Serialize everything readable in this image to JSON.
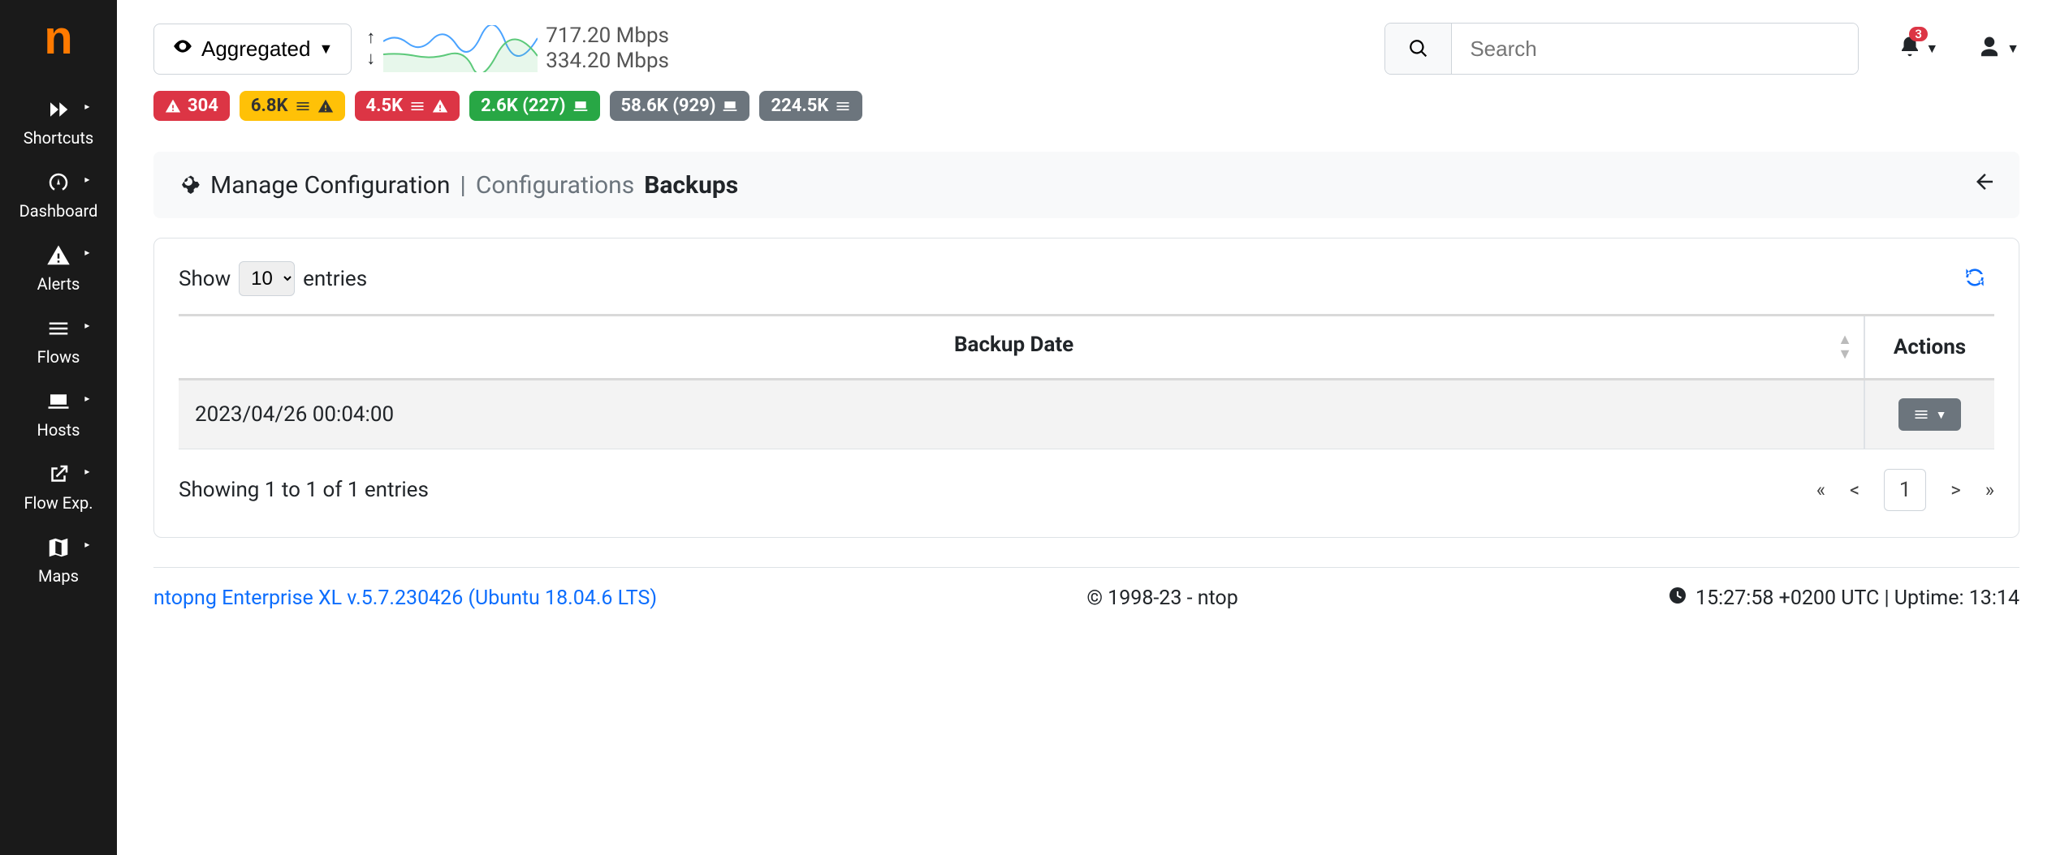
{
  "sidebar": {
    "items": [
      {
        "label": "Shortcuts",
        "icon": "forward"
      },
      {
        "label": "Dashboard",
        "icon": "gauge"
      },
      {
        "label": "Alerts",
        "icon": "alert"
      },
      {
        "label": "Flows",
        "icon": "bars"
      },
      {
        "label": "Hosts",
        "icon": "laptop"
      },
      {
        "label": "Flow Exp.",
        "icon": "export"
      },
      {
        "label": "Maps",
        "icon": "map"
      }
    ]
  },
  "topbar": {
    "aggregated_label": "Aggregated",
    "traffic_up": "717.20 Mbps",
    "traffic_down": "334.20 Mbps",
    "search_placeholder": "Search",
    "notification_count": "3"
  },
  "status_badges": [
    {
      "text": "304",
      "color": "red",
      "icons": [
        "alert"
      ]
    },
    {
      "text": "6.8K",
      "color": "yellow",
      "icons": [
        "bars",
        "alert"
      ]
    },
    {
      "text": "4.5K",
      "color": "red",
      "icons": [
        "bars",
        "alert"
      ]
    },
    {
      "text": "2.6K (227)",
      "color": "green",
      "icons": [
        "laptop"
      ]
    },
    {
      "text": "58.6K (929)",
      "color": "gray",
      "icons": [
        "laptop"
      ]
    },
    {
      "text": "224.5K",
      "color": "gray",
      "icons": [
        "bars"
      ]
    }
  ],
  "breadcrumb": {
    "title": "Manage Configuration",
    "link": "Configurations",
    "active": "Backups"
  },
  "table": {
    "show_label": "Show",
    "entries_label": "entries",
    "entries_selected": "10",
    "headers": {
      "backup_date": "Backup Date",
      "actions": "Actions"
    },
    "rows": [
      {
        "backup_date": "2023/04/26 00:04:00"
      }
    ],
    "showing_text": "Showing 1 to 1 of 1 entries",
    "pager": {
      "first": "«",
      "prev": "<",
      "current": "1",
      "next": ">",
      "last": "»"
    }
  },
  "footer": {
    "product_link": "ntopng Enterprise XL v.5.7.230426 (Ubuntu 18.04.6 LTS)",
    "copyright": "© 1998-23 - ntop",
    "time_text": "15:27:58 +0200 UTC | Uptime: 13:14"
  }
}
